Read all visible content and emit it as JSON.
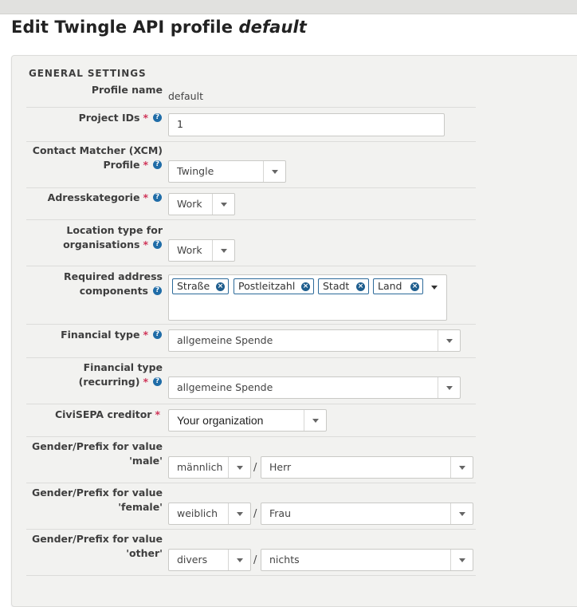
{
  "page": {
    "title_prefix": "Edit Twingle API profile",
    "title_name": "default"
  },
  "section": {
    "title": "GENERAL SETTINGS"
  },
  "required_marker": "*",
  "help_glyph": "?",
  "fields": {
    "profile_name": {
      "label": "Profile name",
      "value": "default"
    },
    "project_ids": {
      "label": "Project IDs",
      "value": "1"
    },
    "contact_matcher": {
      "label_line1": "Contact Matcher (XCM)",
      "label_line2": "Profile",
      "value": "Twingle"
    },
    "adresskategorie": {
      "label": "Adresskategorie",
      "value": "Work"
    },
    "location_type_org": {
      "label_line1": "Location type for",
      "label_line2": "organisations",
      "value": "Work"
    },
    "required_address": {
      "label_line1": "Required address",
      "label_line2": "components",
      "tags": [
        "Straße",
        "Postleitzahl",
        "Stadt",
        "Land"
      ]
    },
    "financial_type": {
      "label": "Financial type",
      "value": "allgemeine Spende"
    },
    "financial_type_recurring": {
      "label_line1": "Financial type",
      "label_line2": "(recurring)",
      "value": "allgemeine Spende"
    },
    "civisepa_creditor": {
      "label": "CiviSEPA creditor",
      "value": "Your organization"
    },
    "gender_male": {
      "label_line1": "Gender/Prefix for value",
      "label_line2": "'male'",
      "gender": "männlich",
      "prefix": "Herr"
    },
    "gender_female": {
      "label_line1": "Gender/Prefix for value",
      "label_line2": "'female'",
      "gender": "weiblich",
      "prefix": "Frau"
    },
    "gender_other": {
      "label_line1": "Gender/Prefix for value",
      "label_line2": "'other'",
      "gender": "divers",
      "prefix": "nichts"
    }
  },
  "separator": "/",
  "colors": {
    "required": "#cf3458",
    "help_icon": "#1f6ca7",
    "tag_border": "#2c6a9a"
  }
}
